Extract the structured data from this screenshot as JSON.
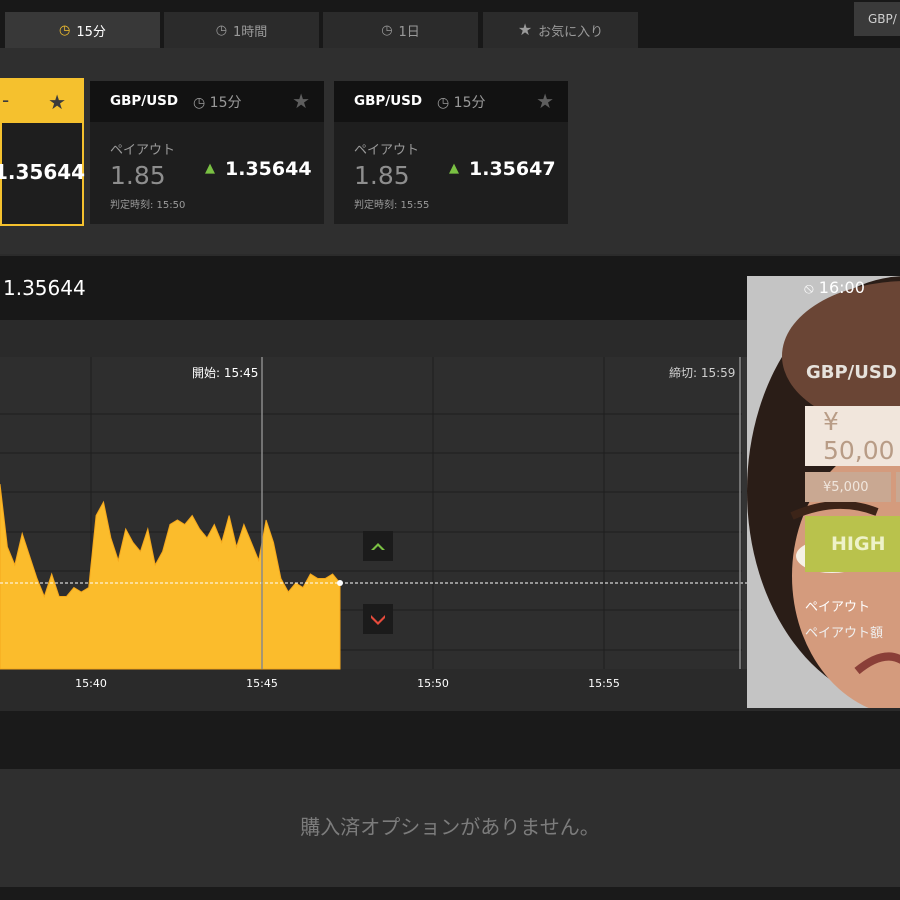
{
  "tabs": [
    {
      "label": "15分",
      "icon": "clock-icon",
      "active": true
    },
    {
      "label": "1時間",
      "icon": "clock-icon",
      "active": false
    },
    {
      "label": "1日",
      "icon": "clock-icon",
      "active": false
    },
    {
      "label": "お気に入り",
      "icon": "star-icon",
      "active": false
    }
  ],
  "header_right_button": "GBP/",
  "selected_card": {
    "price": "1.35644"
  },
  "cards": [
    {
      "pair": "GBP/USD",
      "duration": "15分",
      "payout_label": "ペイアウト",
      "payout": "1.85",
      "price": "1.35644",
      "deadline": "判定時刻: 15:50"
    },
    {
      "pair": "GBP/USD",
      "duration": "15分",
      "payout_label": "ペイアウト",
      "payout": "1.85",
      "price": "1.35647",
      "deadline": "判定時刻: 15:55"
    }
  ],
  "current_rate": "1.35644",
  "chart": {
    "start_label": "開始: 15:45",
    "close_label": "締切: 15:59",
    "x_ticks": [
      "15:40",
      "15:45",
      "15:50",
      "15:55"
    ]
  },
  "chart_data": {
    "type": "area",
    "title": "",
    "x_ticks": [
      "15:40",
      "15:45",
      "15:50",
      "15:55"
    ],
    "markers": {
      "start": "15:45",
      "close": "15:59"
    },
    "current_value": 1.35644,
    "series": [
      {
        "values": [
          1.35666,
          1.35652,
          1.35648,
          1.35655,
          1.3565,
          1.35645,
          1.35641,
          1.35646,
          1.35641,
          1.35641,
          1.35643,
          1.35642,
          1.35643,
          1.35659,
          1.35662,
          1.35654,
          1.35649,
          1.35656,
          1.35653,
          1.35651,
          1.35656,
          1.35648,
          1.35651,
          1.35657,
          1.35658,
          1.35657,
          1.35659,
          1.35656,
          1.35654,
          1.35657,
          1.35653,
          1.35659,
          1.35652,
          1.35657,
          1.35653,
          1.35649,
          1.35658,
          1.35653,
          1.35645,
          1.35642,
          1.35644,
          1.35643,
          1.35646,
          1.35645,
          1.35645,
          1.35646,
          1.35644
        ]
      }
    ],
    "colors": {
      "area": "#fbbc2c",
      "high_marker": "#7ac143",
      "low_marker": "#e64b3c"
    }
  },
  "panel": {
    "time": "16:00",
    "pair": "GBP/USD",
    "amount": "¥ 50,00",
    "quick_amount": "¥5,000",
    "high_label": "HIGH",
    "payout_label": "ペイアウト",
    "payout_amount_label": "ペイアウト額"
  },
  "empty_message": "購入済オプションがありません。",
  "colors": {
    "accent": "#f5c12e",
    "up": "#7ac143",
    "down": "#e64b3c"
  }
}
